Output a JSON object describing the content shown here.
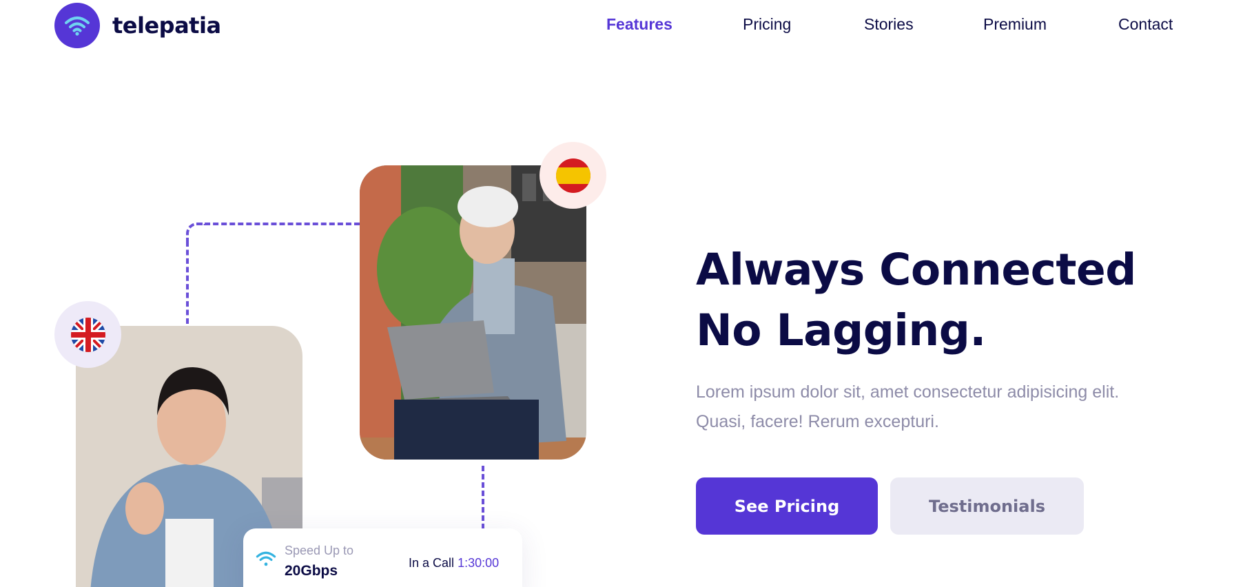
{
  "brand": {
    "name": "telepatia",
    "icon": "wifi-icon",
    "color": "#5536d6"
  },
  "nav": {
    "items": [
      {
        "label": "Features",
        "active": true
      },
      {
        "label": "Pricing",
        "active": false
      },
      {
        "label": "Stories",
        "active": false
      },
      {
        "label": "Premium",
        "active": false
      },
      {
        "label": "Contact",
        "active": false
      }
    ]
  },
  "hero": {
    "headline_line1": "Always Connected",
    "headline_line2": "No Lagging.",
    "description": "Lorem ipsum dolor sit, amet consectetur adipisicing elit. Quasi, facere! Rerum excepturi.",
    "primary_button": "See Pricing",
    "secondary_button": "Testimonials"
  },
  "stat_card": {
    "label": "Speed Up to",
    "value": "20Gbps",
    "call_label": "In a Call",
    "call_time": "1:30:00",
    "icon": "wifi-icon"
  },
  "flags": {
    "top": "spain-flag-icon",
    "left": "uk-flag-icon"
  },
  "colors": {
    "accent": "#5536d6",
    "heading": "#0b0b45",
    "muted": "#8d8ba8",
    "secondary_bg": "#ebeaf4"
  }
}
